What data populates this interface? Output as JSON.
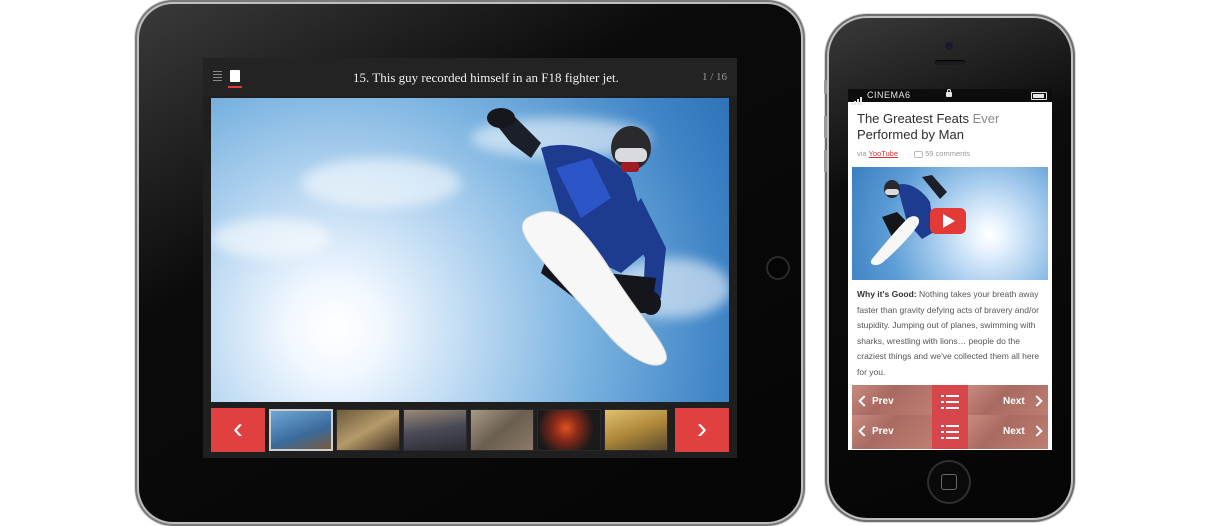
{
  "ipad": {
    "slide_title": "15. This guy recorded himself in an F18 fighter jet.",
    "slide_counter": "1 / 16",
    "prev_glyph": "‹",
    "next_glyph": "›"
  },
  "iphone": {
    "carrier": "CINEMA6",
    "article_title_main": "The Greatest Feats",
    "article_title_muted": "Ever",
    "article_title_end": "Performed by Man",
    "via_label": "via",
    "source_link": "YooTube",
    "comments": "59 comments",
    "why_label": "Why it's Good:",
    "body": "Nothing takes your breath away faster than gravity defying acts of bravery and/or stupidity. Jumping out of planes, swimming with sharks, wrestling with lions… people do the craziest things and we've collected them all here for you.",
    "prev_label": "Prev",
    "next_label": "Next"
  },
  "colors": {
    "accent_red": "#e04040",
    "link_red": "#dd3333"
  }
}
